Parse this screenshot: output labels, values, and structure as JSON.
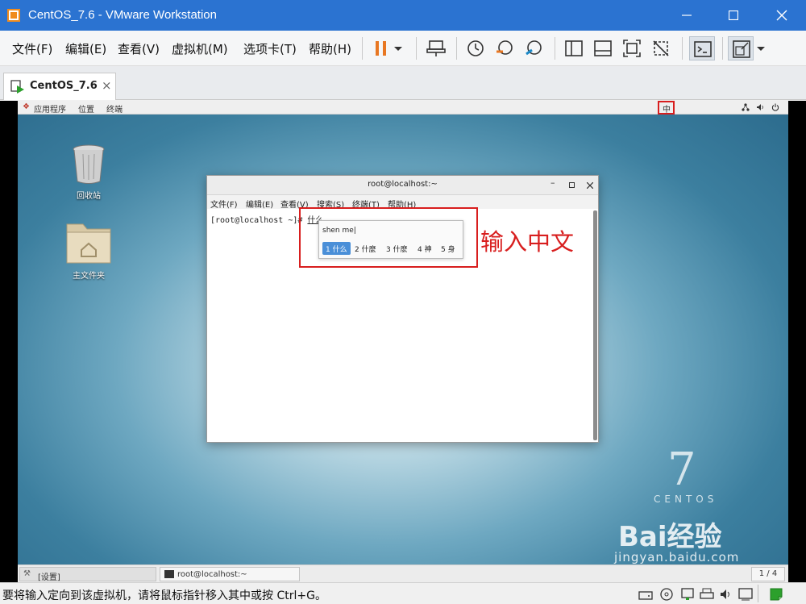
{
  "window": {
    "title": "CentOS_7.6 - VMware Workstation"
  },
  "menu": {
    "file": "文件(F)",
    "edit": "编辑(E)",
    "view": "查看(V)",
    "vm": "虚拟机(M)",
    "tabs": "选项卡(T)",
    "help": "帮助(H)"
  },
  "tab": {
    "label": "CentOS_7.6",
    "close": "×"
  },
  "guest": {
    "topbar": {
      "apps": "应用程序",
      "places": "位置",
      "terminal": "终端",
      "ime_indicator": "中"
    },
    "desktop": {
      "trash_label": "回收站",
      "home_label": "主文件夹"
    },
    "terminal": {
      "title": "root@localhost:~",
      "menu": [
        "文件(F)",
        "编辑(E)",
        "查看(V)",
        "搜索(S)",
        "终端(T)",
        "帮助(H)"
      ],
      "prompt": "[root@localhost ~]# ",
      "typed": "什么"
    },
    "ime": {
      "pinyin": "shen me|",
      "candidates": [
        "1 什么",
        "2 什麼",
        "3 什麽",
        "4 神",
        "5 身"
      ],
      "selected_index": 0
    },
    "annotation": "输入中文",
    "centos_mark": {
      "number": "7",
      "word": "CENTOS"
    },
    "taskbar": {
      "settings": "[设置]",
      "terminal": "root@localhost:~",
      "workspace": "1 / 4"
    },
    "watermark": {
      "brand": "Bai经验",
      "url": "jingyan.baidu.com"
    }
  },
  "statusbar": {
    "message": "要将输入定向到该虚拟机，请将鼠标指针移入其中或按 Ctrl+G。"
  },
  "colors": {
    "titlebar": "#2b73d1",
    "annotation_red": "#d81e1e",
    "selected_candidate": "#4a8fd8"
  }
}
